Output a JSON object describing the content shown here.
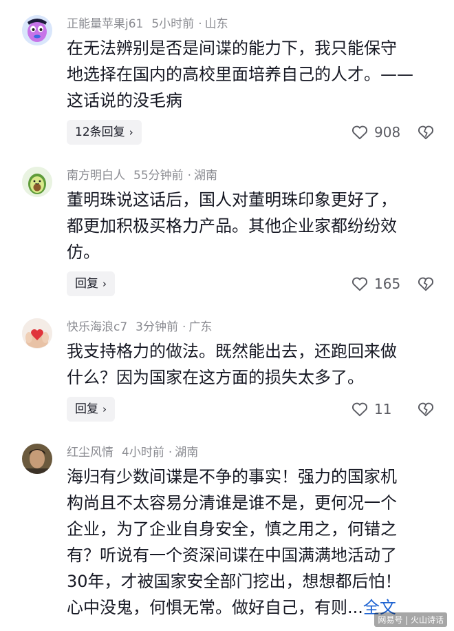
{
  "comments": [
    {
      "user": "正能量苹果j61",
      "time": "5小时前",
      "location": "山东",
      "lines": [
        "在无法辨别是否是间谍的能力下，我只能保守",
        "地选择在国内的高校里面培养自己的人才。——",
        "这话说的没毛病"
      ],
      "reply_label": "12条回复",
      "likes": "908",
      "avatar_icon": "cartoon-face-avatar"
    },
    {
      "user": "南方明白人",
      "time": "55分钟前",
      "location": "湖南",
      "lines": [
        "董明珠说这话后，国人对董明珠印象更好了，",
        "都更加积极买格力产品。其他企业家都纷纷效",
        "仿。"
      ],
      "reply_label": "回复",
      "likes": "165",
      "avatar_icon": "avocado-avatar"
    },
    {
      "user": "快乐海浪c7",
      "time": "3分钟前",
      "location": "广东",
      "lines": [
        "我支持格力的做法。既然能出去，还跑回来做",
        "什么？因为国家在这方面的损失太多了。"
      ],
      "reply_label": "回复",
      "likes": "11",
      "avatar_icon": "hands-heart-avatar"
    },
    {
      "user": "红尘风情",
      "time": "4小时前",
      "location": "湖南",
      "lines": [
        "海归有少数间谍是不争的事实！强力的国家机",
        "构尚且不太容易分清谁是谁不是，更何况一个",
        "企业，为了企业自身安全，慎之用之，何错之",
        "有？听说有一个资深间谍在中国满满地活动了",
        "30年，才被国家安全部门挖出，想想都后怕！",
        "心中没鬼，何惧无常。做好自己，有则..."
      ],
      "more_label": "全文",
      "avatar_icon": "portrait-avatar"
    }
  ],
  "watermark": "网易号 | 火山诗话",
  "colors": {
    "link": "#1f64d2",
    "meta": "#8a8b91",
    "text": "#161823"
  }
}
